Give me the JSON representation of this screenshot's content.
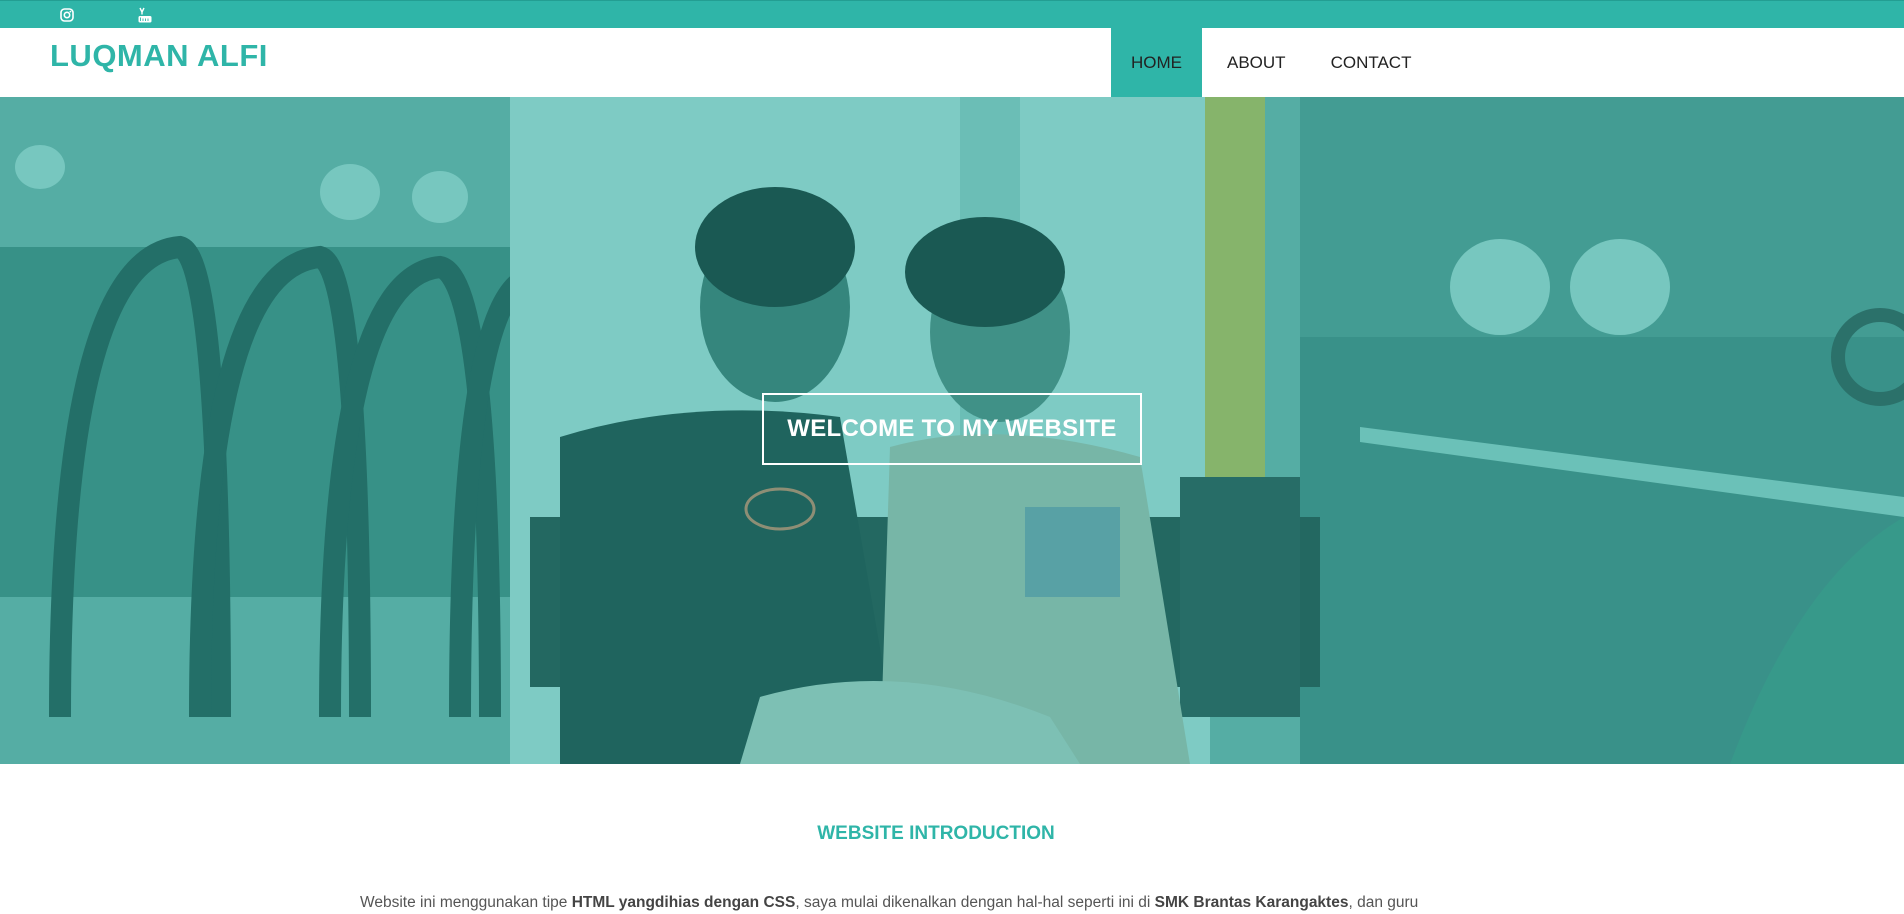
{
  "topbar": {
    "icons": [
      "instagram-icon",
      "youtube-icon"
    ],
    "color": "#2fb5a8"
  },
  "brand": "LUQMAN ALFI",
  "nav": {
    "items": [
      {
        "label": "HOME",
        "active": true
      },
      {
        "label": "ABOUT",
        "active": false
      },
      {
        "label": "CONTACT",
        "active": false
      }
    ]
  },
  "hero": {
    "button_label": "WELCOME TO MY WEBSITE"
  },
  "intro": {
    "title": "WEBSITE INTRODUCTION",
    "text_1": "Website ini menggunakan tipe ",
    "text_bold_1": "HTML yangdihias dengan CSS",
    "text_2": ", saya mulai dikenalkan dengan hal-hal seperti ini di ",
    "text_bold_2": "SMK Brantas Karangaktes",
    "text_3": ", dan guru"
  },
  "colors": {
    "accent": "#2fb5a8",
    "text": "#222222"
  }
}
